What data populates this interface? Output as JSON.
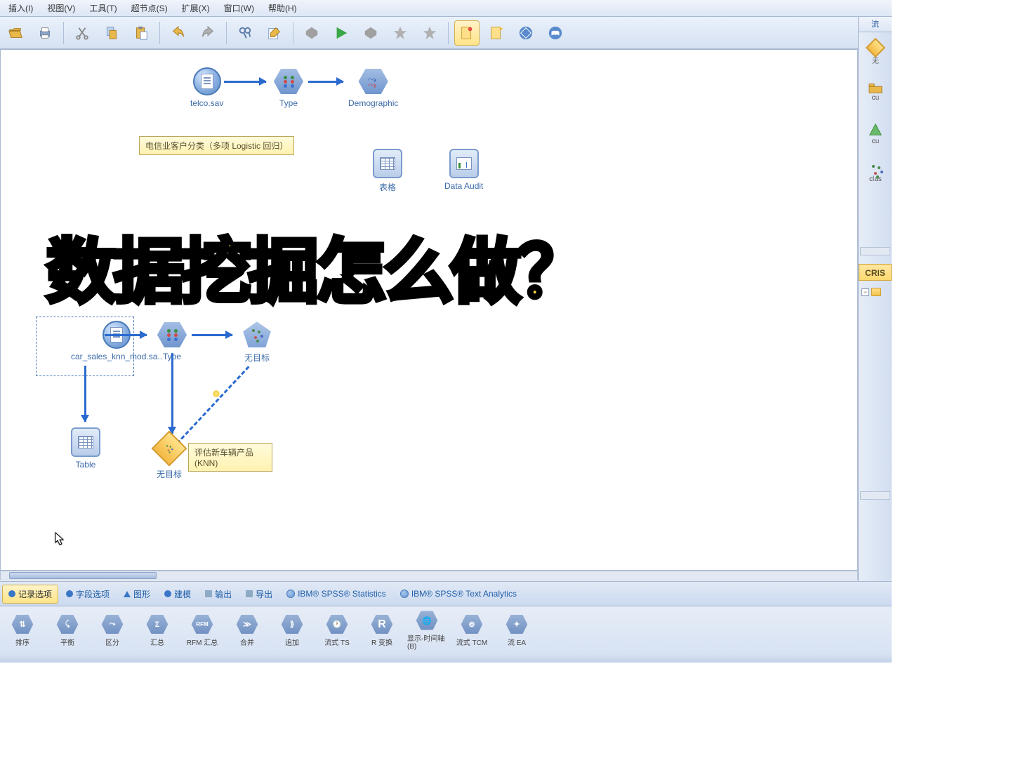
{
  "menu": {
    "insert": "插入(I)",
    "view": "视图(V)",
    "tools": "工具(T)",
    "supernode": "超节点(S)",
    "extend": "扩展(X)",
    "window": "窗口(W)",
    "help": "帮助(H)"
  },
  "overlay_title": "数据挖掘怎么做？",
  "annotations": {
    "telco": "电信业客户分类（多项 Logistic 回归）",
    "knn_line1": "评估新车辆产品",
    "knn_line2": "(KNN)"
  },
  "nodes": {
    "telco": "telco.sav",
    "type1": "Type",
    "demographic": "Demographic",
    "table_cn": "表格",
    "data_audit": "Data Audit",
    "car_sales": "car_sales_knn_mod.sa..",
    "type2": "Type",
    "notarget1": "无目标",
    "table_en": "Table",
    "notarget2": "无目标"
  },
  "right": {
    "tab": "流",
    "i1": "无",
    "i2": "cu",
    "i3": "cu",
    "i4": "clas",
    "crisp": "CRIS"
  },
  "tabs": {
    "record": "记录选项",
    "field": "字段选项",
    "graph": "图形",
    "model": "建模",
    "output": "输出",
    "export": "导出",
    "spss_stats": "IBM® SPSS® Statistics",
    "spss_text": "IBM® SPSS® Text Analytics"
  },
  "palette": {
    "p1": "排序",
    "p2": "平衡",
    "p3": "区分",
    "p4": "汇总",
    "p5": "RFM 汇总",
    "p6": "合并",
    "p7": "追加",
    "p8": "流式 TS",
    "p9": "R 变换",
    "p10": "显示-时间轴(B)",
    "p11": "流式 TCM",
    "p12": "流 EA"
  }
}
